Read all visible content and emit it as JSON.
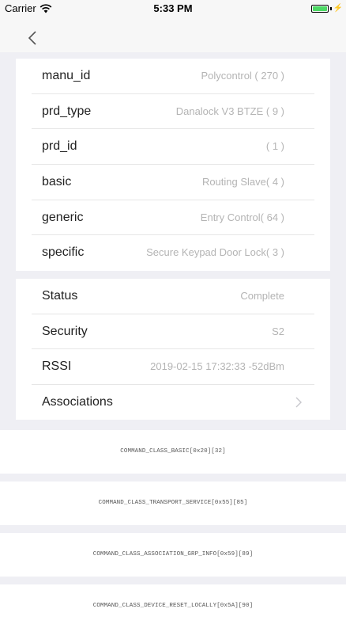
{
  "statusbar": {
    "carrier": "Carrier",
    "time": "5:33 PM"
  },
  "nav": {
    "back_icon": "chevron-left-icon"
  },
  "info": [
    {
      "key": "manu_id",
      "value": "Polycontrol ( 270 )"
    },
    {
      "key": "prd_type",
      "value": "Danalock V3 BTZE ( 9 )"
    },
    {
      "key": "prd_id",
      "value": "( 1 )"
    },
    {
      "key": "basic",
      "value": "Routing Slave( 4 )"
    },
    {
      "key": "generic",
      "value": "Entry Control( 64 )"
    },
    {
      "key": "specific",
      "value": "Secure Keypad Door Lock( 3 )"
    }
  ],
  "status": [
    {
      "key": "Status",
      "value": "Complete"
    },
    {
      "key": "Security",
      "value": "S2"
    },
    {
      "key": "RSSI",
      "value": "2019-02-15 17:32:33 -52dBm"
    },
    {
      "key": "Associations",
      "value": ""
    }
  ],
  "command_classes": [
    "COMMAND_CLASS_BASIC[0x20][32]",
    "COMMAND_CLASS_TRANSPORT_SERVICE[0x55][85]",
    "COMMAND_CLASS_ASSOCIATION_GRP_INFO[0x59][89]",
    "COMMAND_CLASS_DEVICE_RESET_LOCALLY[0x5A][90]"
  ],
  "colors": {
    "background": "#efeff4",
    "value_text": "#b4b4b4",
    "battery": "#4cd964"
  }
}
